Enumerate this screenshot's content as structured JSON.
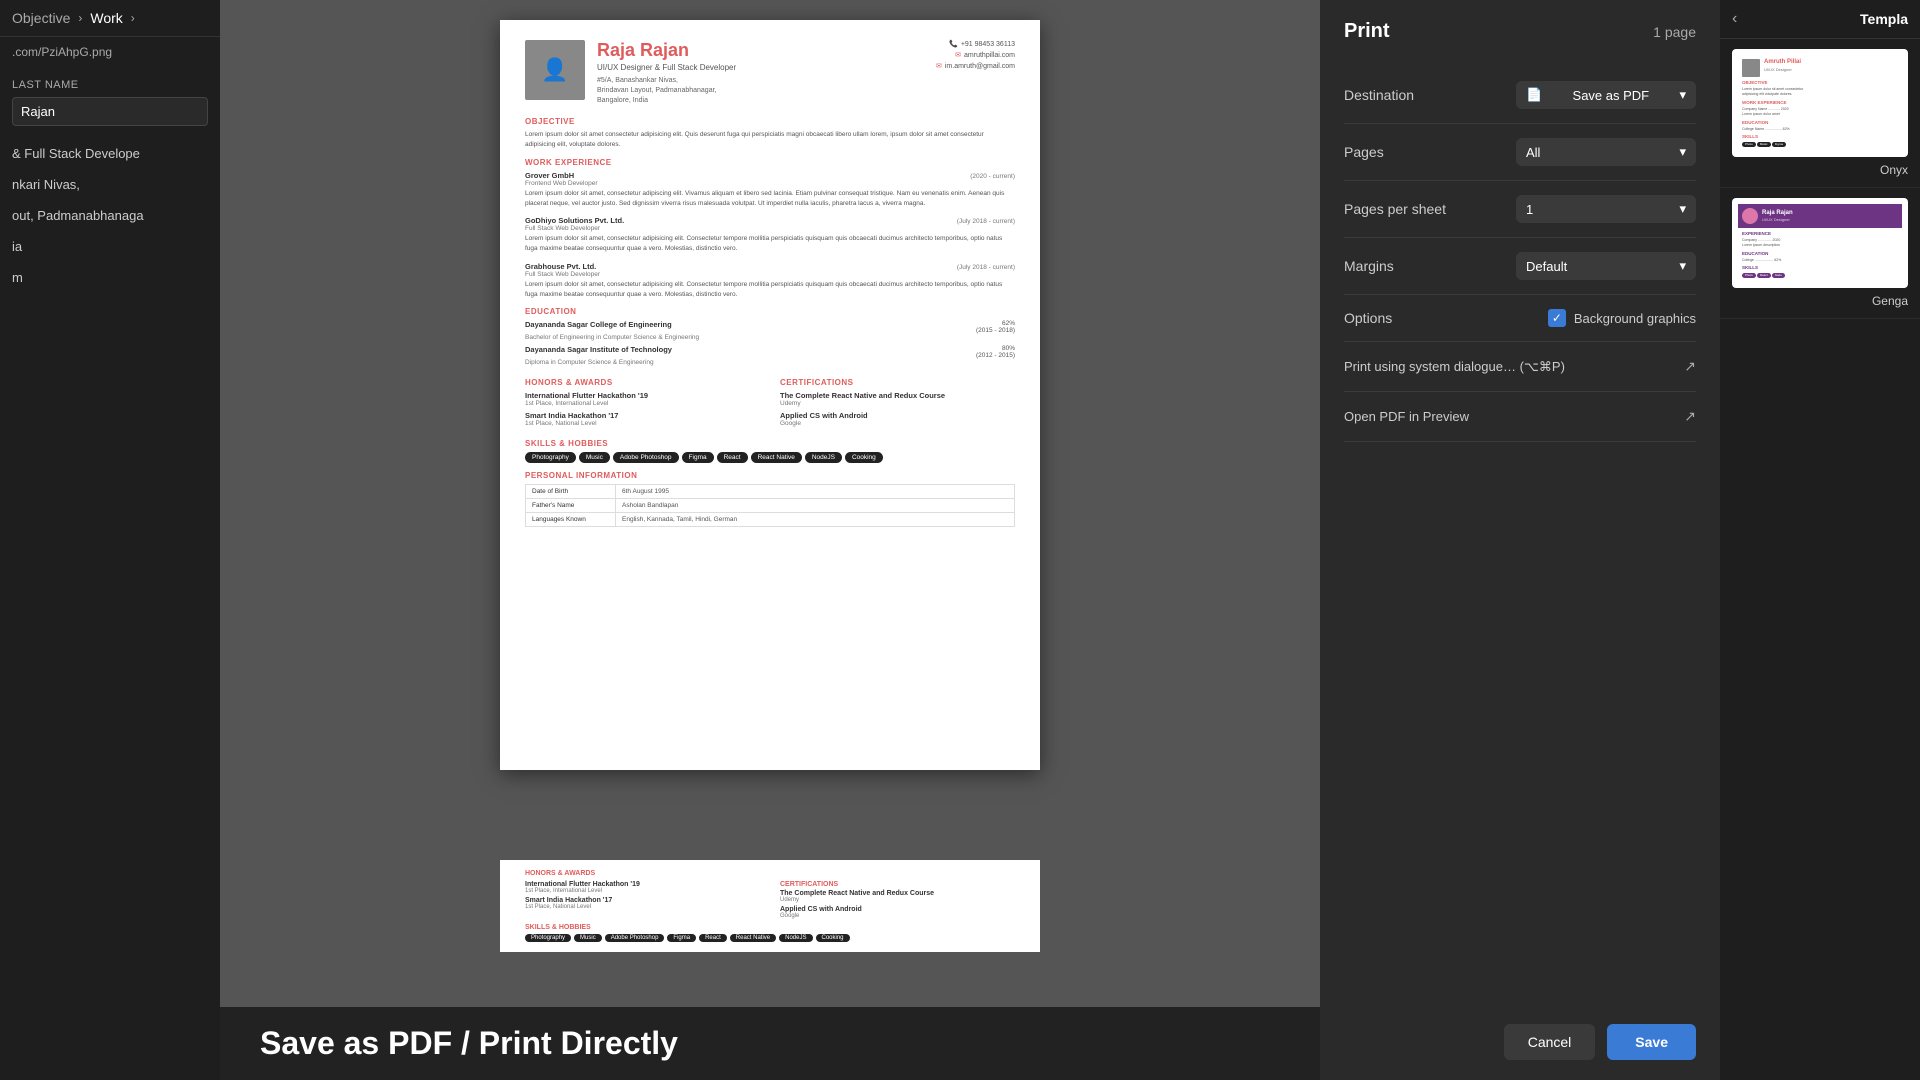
{
  "leftSidebar": {
    "nav": {
      "objective": "Objective",
      "work": "Work",
      "chevron": "›"
    },
    "url": ".com/PziAhpG.png",
    "lastNameLabel": "LAST NAME",
    "lastNameValue": "Rajan",
    "titlePreview": "& Full Stack Develope",
    "address1": "nkari Nivas,",
    "address2": "out, Padmanabhanaga",
    "address3": "ia",
    "phone": "m"
  },
  "print": {
    "title": "Print",
    "pages": "1 page",
    "destination": {
      "label": "Destination",
      "value": "Save as PDF",
      "icon": "📄"
    },
    "pages_field": {
      "label": "Pages",
      "value": "All"
    },
    "pagesPerSheet": {
      "label": "Pages per sheet",
      "value": "1"
    },
    "margins": {
      "label": "Margins",
      "value": "Default"
    },
    "options": {
      "label": "Options",
      "bgGraphics": "Background graphics",
      "checked": true
    },
    "systemDialogue": {
      "label": "Print using system dialogue…",
      "shortcut": "(⌥⌘P)"
    },
    "openPreview": {
      "label": "Open PDF in Preview"
    },
    "cancelLabel": "Cancel",
    "saveLabel": "Save"
  },
  "resume": {
    "name": "Raja Rajan",
    "title": "UI/UX Designer & Full Stack Developer",
    "address": "#5/A, Banashankar Nivas,\nBrindavan Layout, Padmanabhanagar,\nBangalore, India",
    "phone": "+91 98453 36113",
    "email": "amruthpillai.com",
    "emailAlt": "im.amruth@gmail.com",
    "sections": {
      "objective": "OBJECTIVE",
      "objectiveText": "Lorem ipsum dolor sit amet consectetur adipisicing elit. Quis deserunt fuga qui perspiciatis magni obcaecati libero ullam lorem, ipsum dolor sit amet consectetur adipisicing elit, voluptate dolores.",
      "workExperience": "WORK EXPERIENCE",
      "jobs": [
        {
          "company": "Grover GmbH",
          "role": "Frontend Web Developer",
          "period": "(2020 - current)",
          "desc": "Lorem ipsum dolor sit amet, consectetur adipiscing elit. Vivamus aliquam et libero sed lacinia. Etiam pulvinar consequat tristique. Nam eu venenatis enim. Aenean quis placerat neque, vel auctor justo. Sed dignissim viverra risus malesuada volutpat. Ut imperdiet nulla iaculis, pharetra lacus a, viverra magna."
        },
        {
          "company": "GoDhiyo Solutions Pvt. Ltd.",
          "role": "Full Stack Web Developer",
          "period": "(July 2018 - current)",
          "desc": "Lorem ipsum dolor sit amet, consectetur adipisicing elit. Consectetur tempore mollitia perspiciatis quisquam quis obcaecati ducimus architecto temporibus, optio natus fuga maxime beatae consequuntur quae a vero. Molestias, distinctio vero."
        },
        {
          "company": "Grabhouse Pvt. Ltd.",
          "role": "Full Stack Web Developer",
          "period": "(July 2018 - current)",
          "desc": "Lorem ipsum dolor sit amet, consectetur adipisicing elit. Consectetur tempore mollitia perspiciatis quisquam quis obcaecati ducimus architecto temporibus, optio natus fuga maxime beatae consequuntur quae a vero. Molestias, distinctio vero."
        }
      ],
      "education": "EDUCATION",
      "schools": [
        {
          "name": "Dayananda Sagar College of Engineering",
          "degree": "Bachelor of Engineering in Computer Science & Engineering",
          "pct": "62%",
          "period": "(2015 - 2018)"
        },
        {
          "name": "Dayananda Sagar Institute of Technology",
          "degree": "Diploma in Computer Science & Engineering",
          "pct": "80%",
          "period": "(2012 - 2015)"
        }
      ],
      "honors": "HONORS & AWARDS",
      "certifications": "CERTIFICATIONS",
      "awards": [
        {
          "name": "International Flutter Hackathon '19",
          "sub": "1st Place, International Level"
        },
        {
          "name": "Smart India Hackathon '17",
          "sub": "1st Place, National Level"
        }
      ],
      "certs": [
        {
          "name": "The Complete React Native and Redux Course",
          "sub": "Udemy"
        },
        {
          "name": "Applied CS with Android",
          "sub": "Google"
        }
      ],
      "skills": "SKILLS & HOBBIES",
      "skillTags": [
        "Photography",
        "Music",
        "Adobe Photoshop",
        "Figma",
        "React",
        "React Native",
        "NodeJS",
        "Cooking"
      ],
      "personal": "PERSONAL INFORMATION",
      "personalInfo": [
        {
          "label": "Date of Birth",
          "value": "6th August 1995"
        },
        {
          "label": "Father's Name",
          "value": "Asholan Bandlapan"
        },
        {
          "label": "Languages Known",
          "value": "English, Kannada, Tamil, Hindi, German"
        }
      ]
    }
  },
  "banner": {
    "text": "Save as PDF / Print Directly"
  },
  "templates": {
    "headerChevron": "‹",
    "headerTitle": "Templa",
    "items": [
      {
        "name": "Onyx",
        "type": "onyx"
      },
      {
        "name": "Genga",
        "type": "gengatan"
      }
    ]
  },
  "bottomSkills": {
    "sectionTitle": "SKILLS & HOBBIES",
    "tags": [
      "Photography",
      "Music",
      "Adobe Photoshop",
      "Figma",
      "React",
      "React Native",
      "NodeJS",
      "Cooking"
    ]
  }
}
